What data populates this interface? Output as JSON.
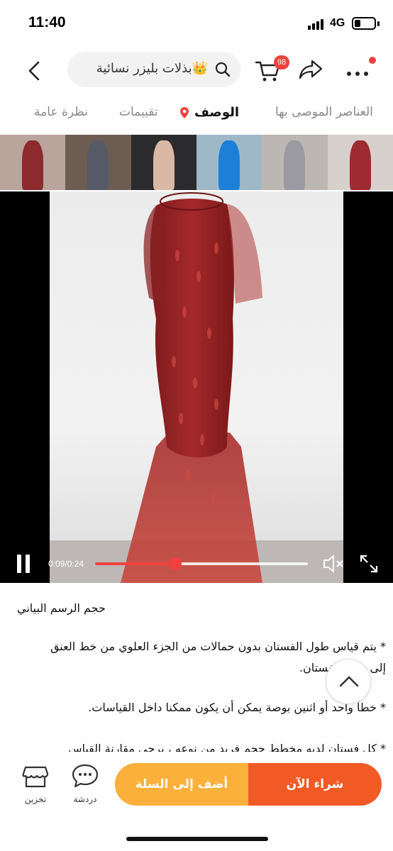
{
  "status_bar": {
    "time": "11:40",
    "network": "4G",
    "battery_level": 0.3
  },
  "header": {
    "search_text": "بذلات بليزر نسائية",
    "search_emoji": "👑",
    "cart_count": "98",
    "icons": [
      "back-icon",
      "search-icon",
      "cart-icon",
      "share-icon",
      "more-icon"
    ]
  },
  "tabs": {
    "recommended": "العناصر الموصى بها",
    "description": "الوصف",
    "reviews": "تقييمات",
    "overview": "نظرة عامة",
    "active": "الوصف"
  },
  "thumbnails": {
    "colors": [
      "#8c2a2e",
      "#555a66",
      "#d9b8a6",
      "#1e7fd8",
      "#9a9aa0",
      "#9e2b31"
    ]
  },
  "video": {
    "time": "0:09/0:24",
    "progress": 0.375,
    "accent": "#f0413e"
  },
  "description": {
    "title": "حجم الرسم البياني",
    "lines": [
      "* يتم قياس طول الفستان بدون حمالات من الجزء العلوي من خط العنق",
      "إلى حافة الفستان.",
      "* خطأ واحد أو اثنين بوصة يمكن أن يكون ممكنا داخل القياسات.",
      "* كل فستان لديه مخطط حجم فريد من نوعه ، يرجى مقارنة القياس"
    ]
  },
  "bottom_bar": {
    "store_label": "تخزين",
    "chat_label": "دردشة",
    "add_to_cart": "أضف إلى السلة",
    "buy_now": "شراء الآن",
    "cart_color": "#fbb03b",
    "buy_color": "#f15a24"
  }
}
